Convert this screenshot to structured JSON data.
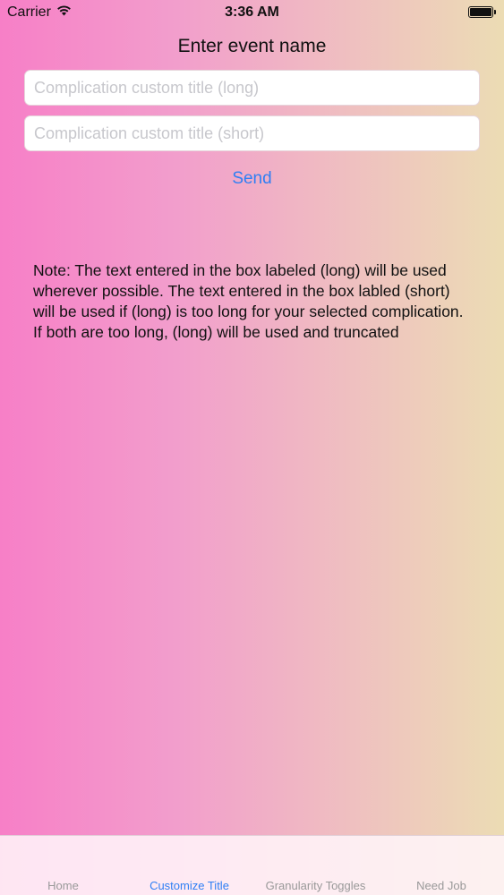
{
  "status_bar": {
    "carrier": "Carrier",
    "time": "3:36 AM",
    "battery_level": 1.0
  },
  "page": {
    "title": "Enter event name",
    "long_field": {
      "placeholder": "Complication custom title (long)",
      "value": ""
    },
    "short_field": {
      "placeholder": "Complication custom title (short)",
      "value": ""
    },
    "send_label": "Send",
    "note": "Note: The text entered in the box labeled (long) will be used wherever possible. The text entered in the box labled (short) will be used if (long) is too long for your selected complication. If both are too long, (long) will be used and truncated"
  },
  "tab_bar": {
    "tabs": [
      {
        "label": "Home",
        "active": false
      },
      {
        "label": "Customize Title",
        "active": true
      },
      {
        "label": "Granularity Toggles",
        "active": false
      },
      {
        "label": "Need Job",
        "active": false
      }
    ]
  },
  "colors": {
    "accent": "#2f7ff4",
    "gradient_left": "#f77fc7",
    "gradient_right": "#ecdcb4"
  }
}
